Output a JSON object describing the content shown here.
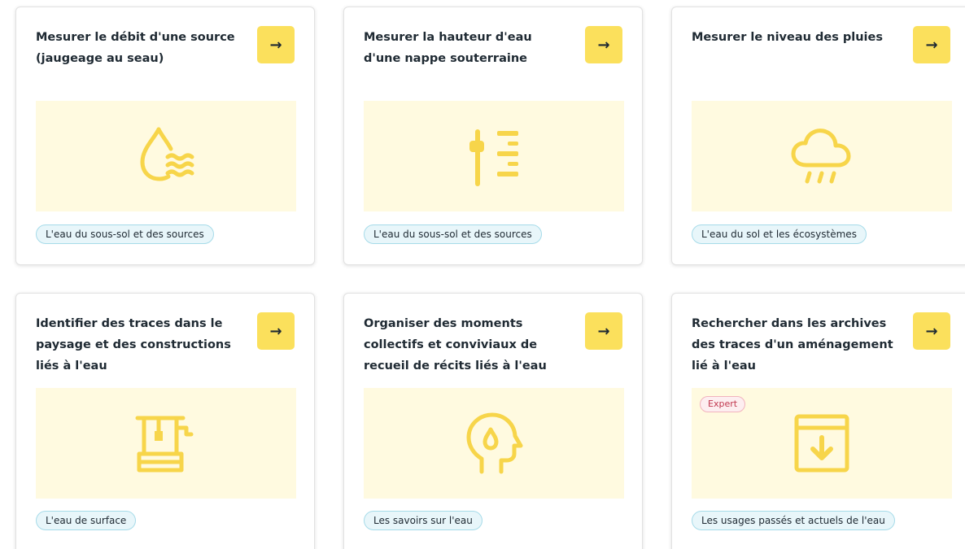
{
  "colors": {
    "accent_yellow": "#fbe05c",
    "illustration_bg": "#fffae0",
    "icon_yellow": "#f7d54a",
    "tag_border": "#a6dbe9",
    "tag_bg": "#e8f6fa",
    "expert_red": "#c0374e"
  },
  "cards": [
    {
      "title": "Mesurer le débit d'une source (jaugeage au seau)",
      "arrow": "→",
      "icon": "water-drop-flow-icon",
      "tag": "L'eau du sous-sol et des sources"
    },
    {
      "title": "Mesurer la hauteur d'eau d'une nappe souterraine",
      "arrow": "→",
      "icon": "water-gauge-icon",
      "tag": "L'eau du sous-sol et des sources"
    },
    {
      "title": "Mesurer le niveau des pluies",
      "arrow": "→",
      "icon": "rain-cloud-icon",
      "tag": "L'eau du sol et les écosystèmes"
    },
    {
      "title": "Identifier des traces dans le paysage et des constructions liés à l'eau",
      "arrow": "→",
      "icon": "water-well-icon",
      "tag": "L'eau de surface"
    },
    {
      "title": "Organiser des moments collectifs et conviviaux de recueil de récits liés à l'eau",
      "arrow": "→",
      "icon": "head-water-drop-icon",
      "tag": "Les savoirs sur l'eau"
    },
    {
      "title": "Rechercher dans les archives des traces d'un aménagement lié à l'eau",
      "arrow": "→",
      "icon": "archive-download-icon",
      "badge": "Expert",
      "tag": "Les usages passés et actuels de l'eau"
    }
  ]
}
